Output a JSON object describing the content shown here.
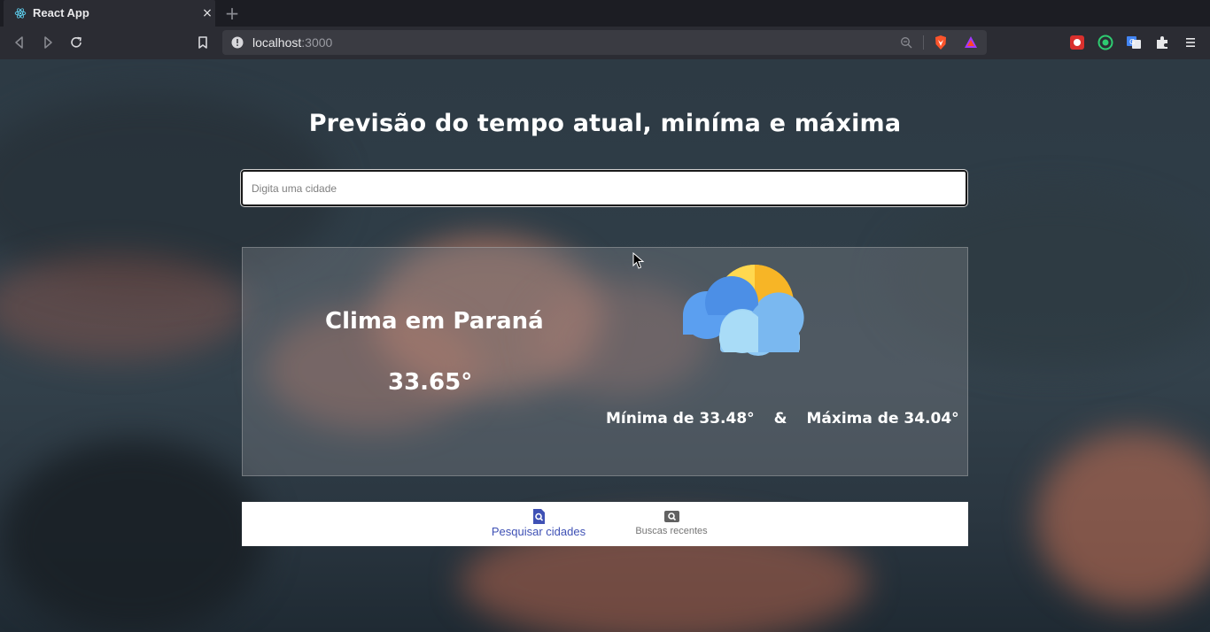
{
  "browser": {
    "tab_title": "React App",
    "tab_close_label": "×",
    "new_tab_label": "+",
    "url_host": "localhost",
    "url_port": ":3000"
  },
  "page": {
    "title": "Previsão do tempo atual, miníma e máxima",
    "search": {
      "placeholder": "Digita uma cidade",
      "value": ""
    },
    "weather": {
      "city_title": "Clima em Paraná",
      "current_temp": "33.65°",
      "min_label": "Mínima de 33.48°",
      "separator": "&",
      "max_label": "Máxima de 34.04°",
      "icon": "partly-cloudy-icon"
    },
    "nav": {
      "search_label": "Pesquisar cidades",
      "recent_label": "Buscas recentes",
      "active": "search"
    }
  },
  "colors": {
    "nav_active": "#3f51b5",
    "nav_inactive": "#757575",
    "browser_bg": "#2b2c33"
  }
}
